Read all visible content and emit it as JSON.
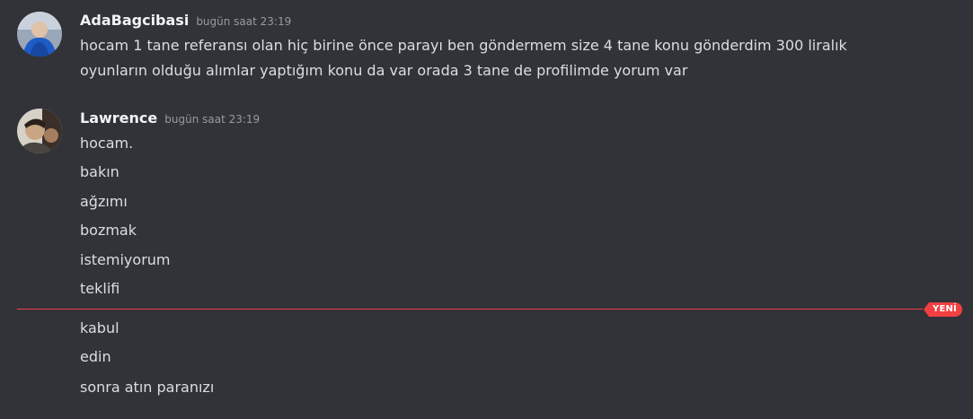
{
  "messages": [
    {
      "author": "AdaBagcibasi",
      "time": "bugün saat 23:19",
      "lines": [
        "hocam 1 tane referansı olan hiç birine önce parayı ben göndermem size 4 tane konu gönderdim 300 liralık",
        "oyunların olduğu alımlar yaptığım konu da var orada 3 tane de profilimde yorum var"
      ]
    },
    {
      "author": "Lawrence",
      "time": "bugün saat 23:19",
      "lines": [
        "hocam.",
        "bakın",
        "ağzımı",
        "bozmak",
        "istemiyorum",
        "teklifi"
      ]
    }
  ],
  "new_divider": {
    "label": "YENİ"
  },
  "after_divider_lines": [
    "kabul",
    "edin",
    "sonra atın paranızı"
  ],
  "colors": {
    "background": "#313338",
    "username": "#f2f3f5",
    "timestamp": "#949ba4",
    "text": "#dbdee1",
    "new_marker": "#f23f42"
  }
}
